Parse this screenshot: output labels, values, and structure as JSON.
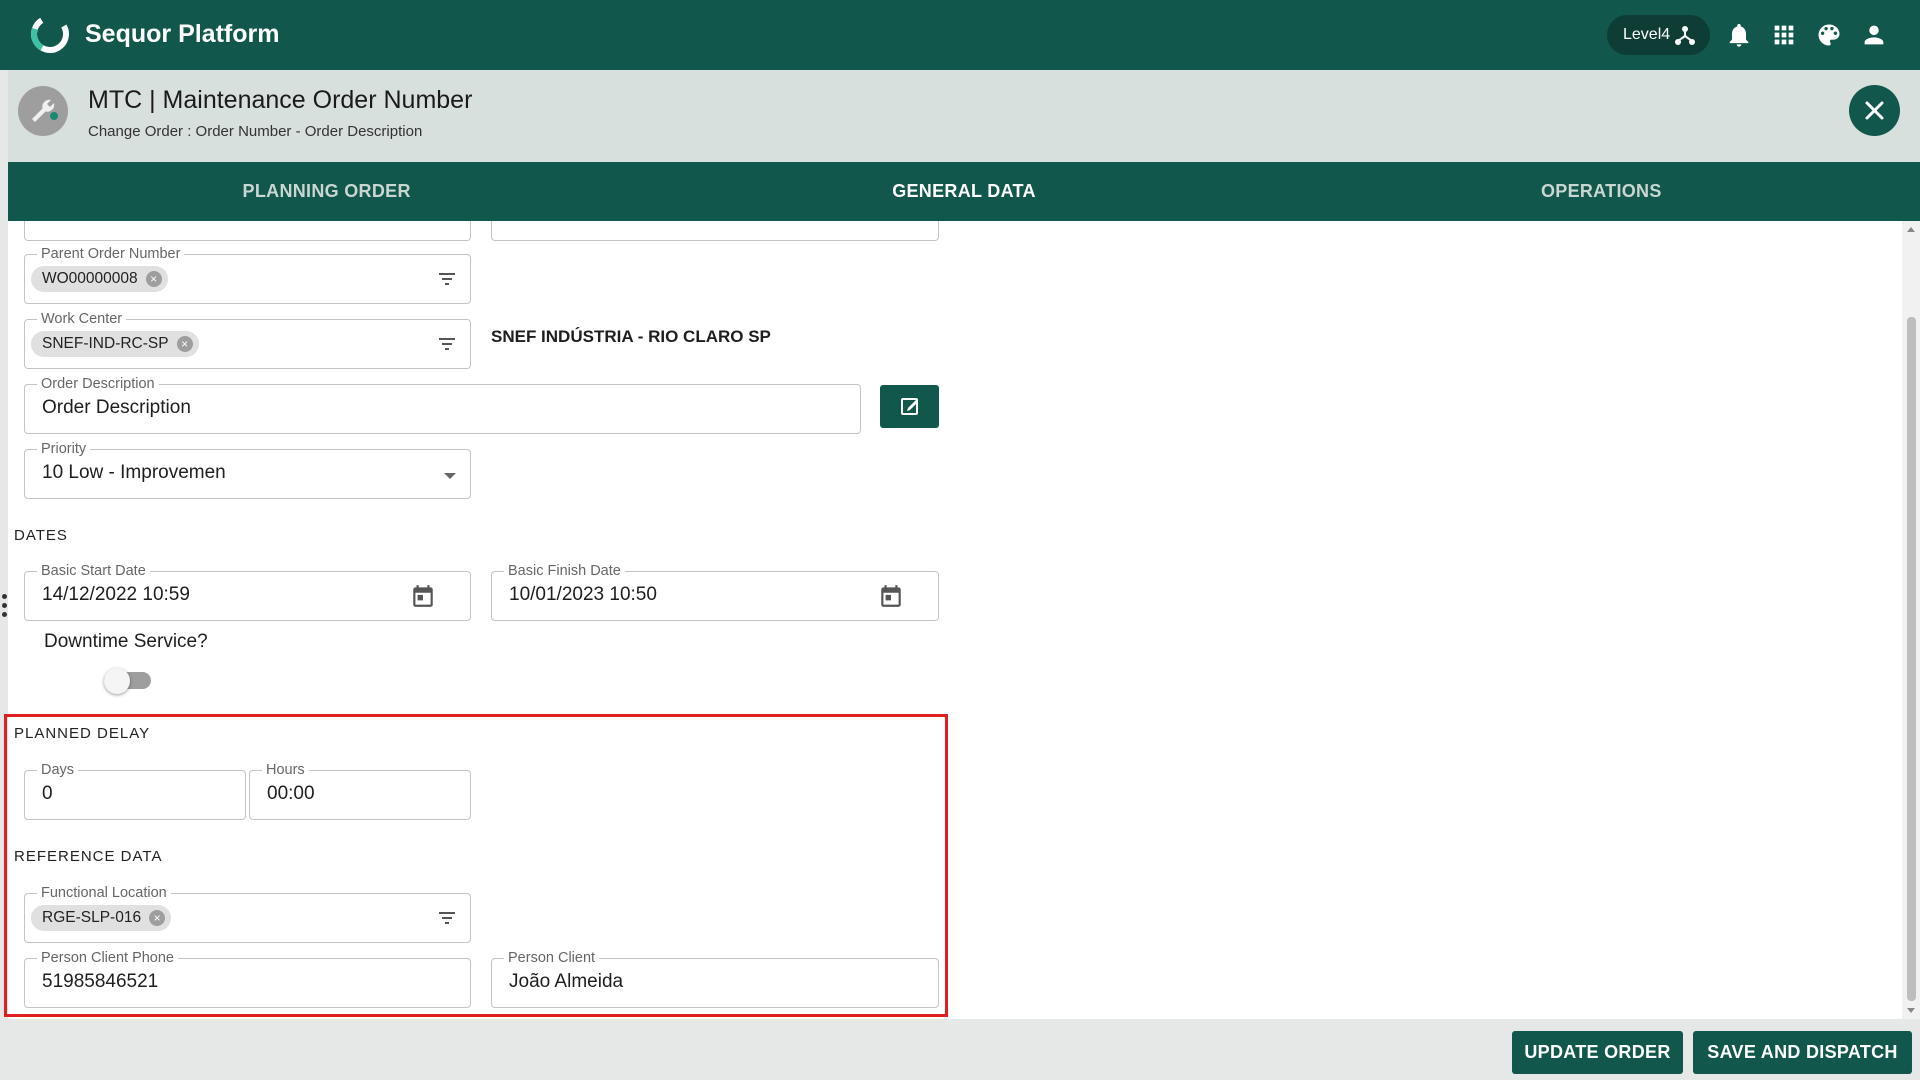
{
  "app": {
    "brand": "Sequor Platform",
    "level": "Level4"
  },
  "header": {
    "title": "MTC | Maintenance Order Number",
    "subtitle": "Change Order : Order Number - Order Description"
  },
  "tabs": [
    {
      "label": "PLANNING ORDER"
    },
    {
      "label": "GENERAL DATA"
    },
    {
      "label": "OPERATIONS"
    }
  ],
  "form": {
    "parent_order": {
      "label": "Parent Order Number",
      "chip": "WO00000008"
    },
    "work_center": {
      "label": "Work Center",
      "chip": "SNEF-IND-RC-SP",
      "description": "SNEF INDÚSTRIA - RIO CLARO SP"
    },
    "order_description": {
      "label": "Order Description",
      "value": "Order Description"
    },
    "priority": {
      "label": "Priority",
      "value": "10 Low - Improvemen"
    },
    "dates_section": "DATES",
    "basic_start": {
      "label": "Basic Start Date",
      "value": "14/12/2022 10:59"
    },
    "basic_finish": {
      "label": "Basic Finish Date",
      "value": "10/01/2023 10:50"
    },
    "downtime_label": "Downtime Service?",
    "downtime_on": false,
    "planned_delay_section": "PLANNED DELAY",
    "days": {
      "label": "Days",
      "value": "0"
    },
    "hours": {
      "label": "Hours",
      "value": "00:00"
    },
    "reference_section": "REFERENCE DATA",
    "functional_location": {
      "label": "Functional Location",
      "chip": "RGE-SLP-016"
    },
    "person_client_phone": {
      "label": "Person Client Phone",
      "value": "51985846521"
    },
    "person_client": {
      "label": "Person Client",
      "value": "João Almeida"
    }
  },
  "footer": {
    "update_label": "UPDATE ORDER",
    "dispatch_label": "SAVE AND DISPATCH"
  },
  "colors": {
    "primary": "#11574b",
    "highlight": "#e02020"
  }
}
